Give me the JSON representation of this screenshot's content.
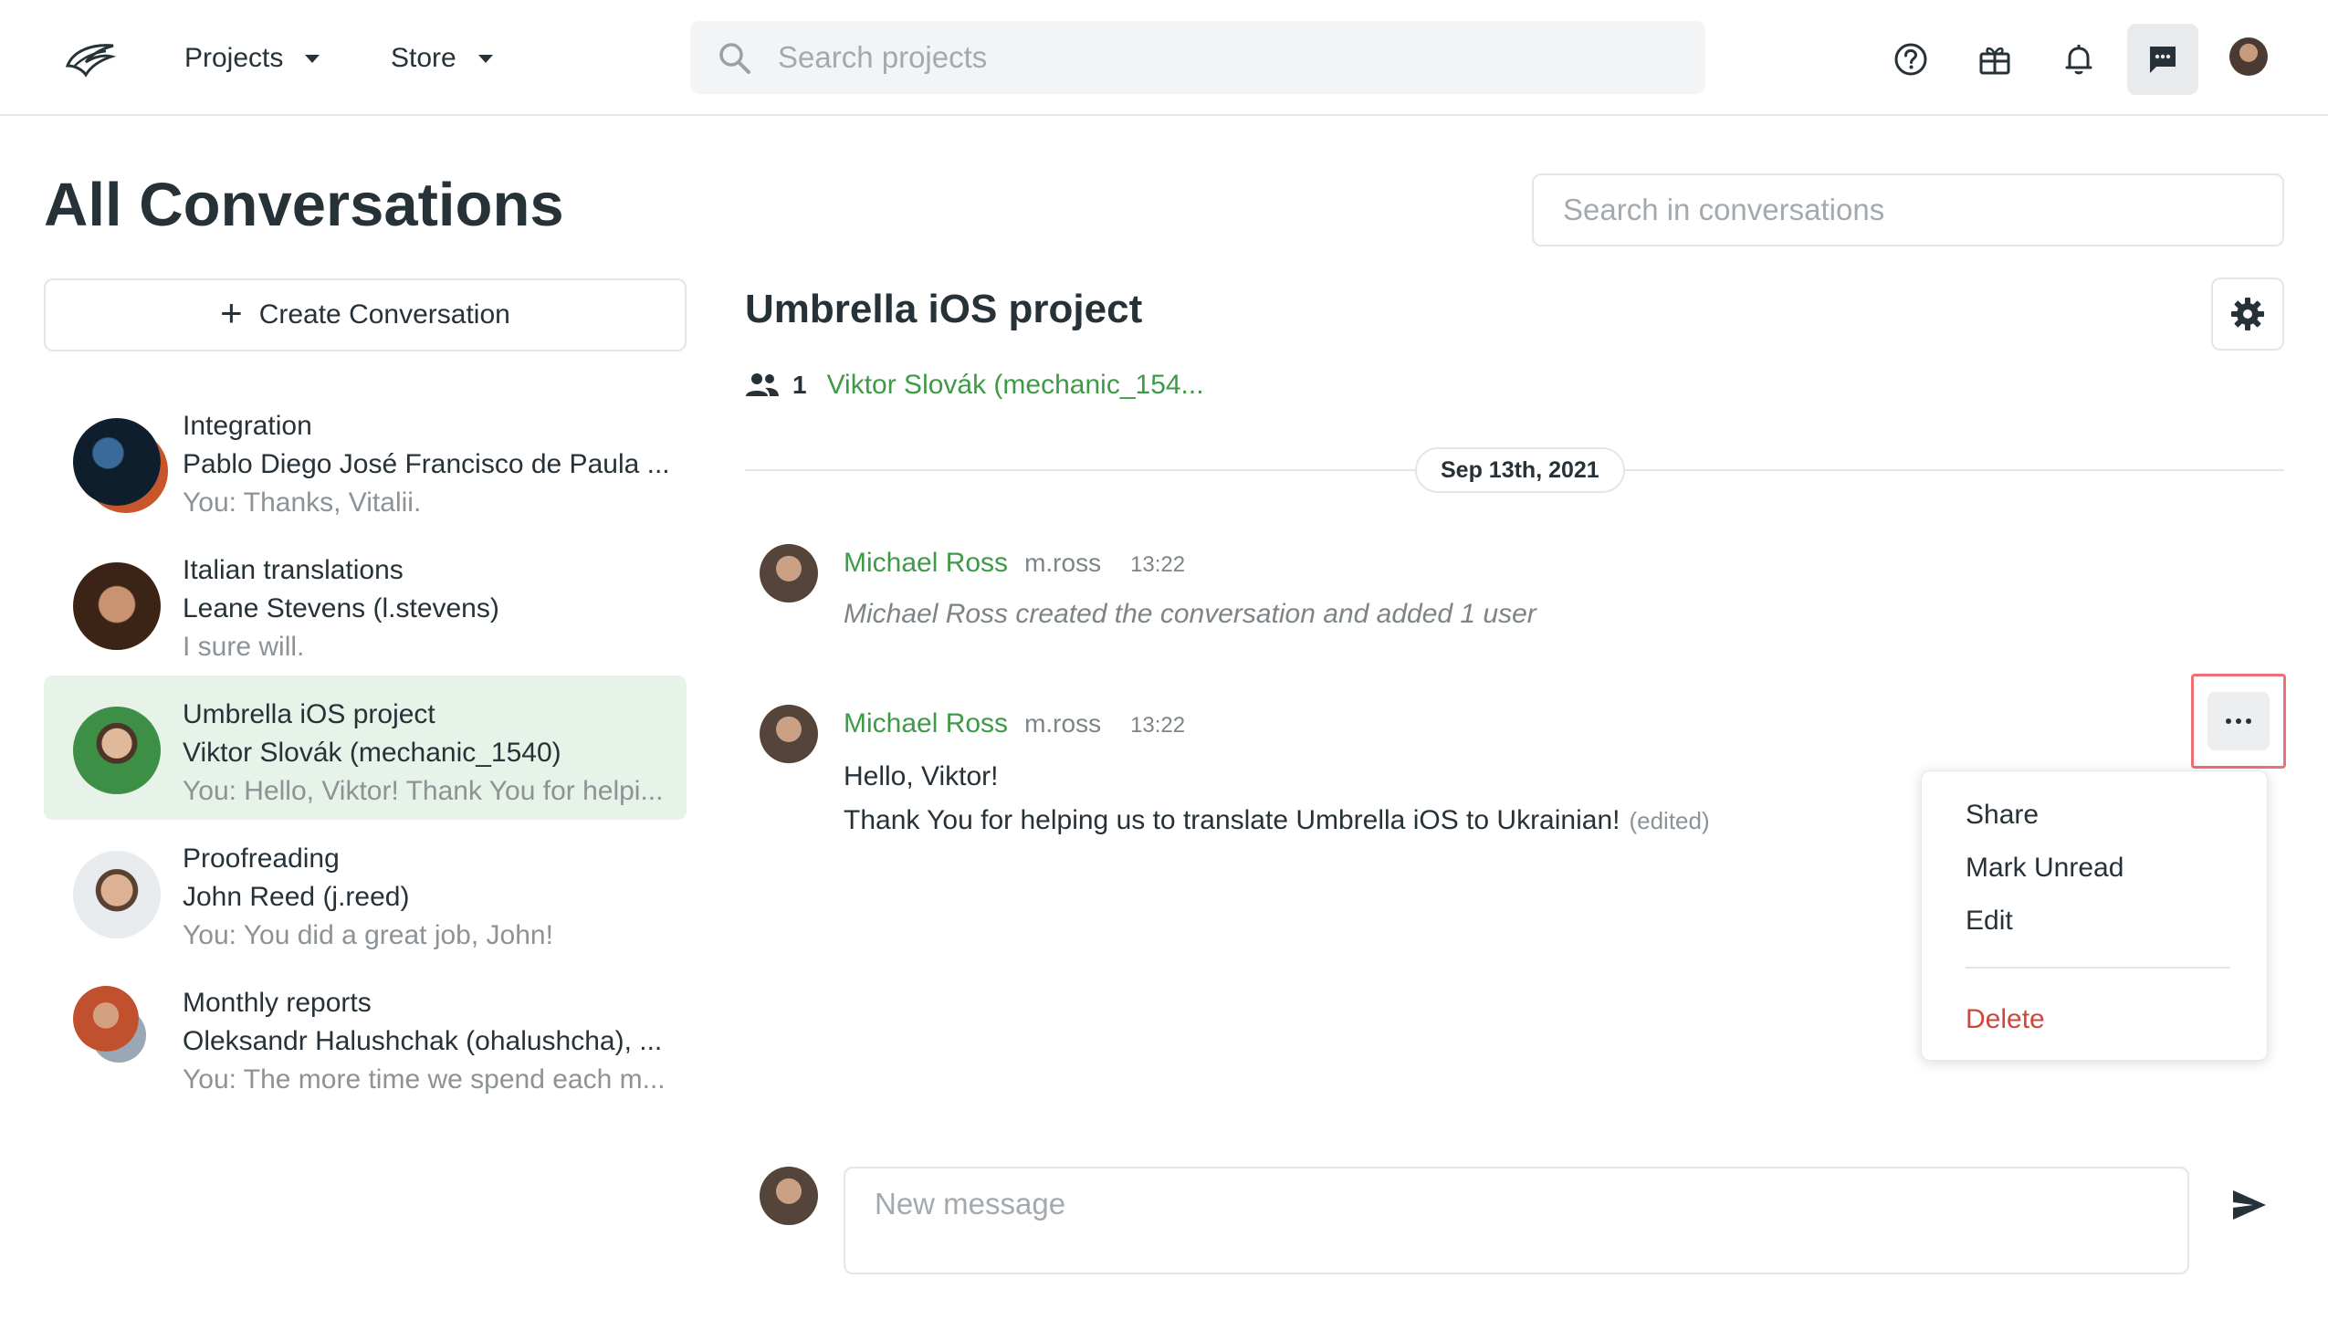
{
  "nav": {
    "projects_label": "Projects",
    "store_label": "Store",
    "search_placeholder": "Search projects"
  },
  "page": {
    "title": "All Conversations",
    "search_placeholder": "Search in conversations",
    "create_label": "Create Conversation"
  },
  "conversations": [
    {
      "title": "Integration",
      "sub": "Pablo Diego José Francisco de Paula ...",
      "last": "You: Thanks, Vitalii."
    },
    {
      "title": "Italian translations",
      "sub": "Leane Stevens (l.stevens)",
      "last": "I sure will."
    },
    {
      "title": "Umbrella iOS project",
      "sub": "Viktor Slovák (mechanic_1540)",
      "last": "You: Hello, Viktor! Thank You for helpi..."
    },
    {
      "title": "Proofreading",
      "sub": "John Reed (j.reed)",
      "last": "You: You did a great job, John!"
    },
    {
      "title": "Monthly reports",
      "sub": "Oleksandr Halushchak (ohalushcha), ...",
      "last": "You: The more time we spend each m..."
    }
  ],
  "conversation": {
    "title": "Umbrella iOS project",
    "member_count": "1",
    "member_name": "Viktor Slovák (mechanic_154...",
    "date": "Sep 13th, 2021"
  },
  "messages": [
    {
      "author": "Michael Ross",
      "username": "m.ross",
      "time": "13:22",
      "system_text": "Michael Ross created the conversation and added 1 user"
    },
    {
      "author": "Michael Ross",
      "username": "m.ross",
      "time": "13:22",
      "line1": "Hello, Viktor!",
      "line2": "Thank You for helping us to translate Umbrella iOS to Ukrainian!",
      "edited": "(edited)"
    }
  ],
  "menu": {
    "share": "Share",
    "mark_unread": "Mark Unread",
    "edit": "Edit",
    "delete": "Delete"
  },
  "composer": {
    "placeholder": "New message"
  },
  "colors": {
    "accent_green": "#3f9a47",
    "selected_bg": "#e7f2e8",
    "danger": "#d0473a",
    "highlight": "#ef6f77"
  }
}
